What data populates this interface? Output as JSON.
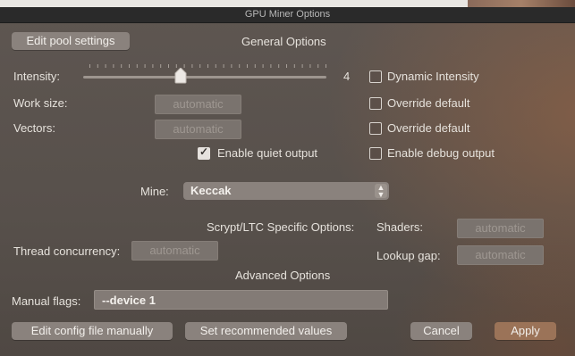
{
  "window": {
    "title": "GPU Miner Options"
  },
  "header": {
    "edit_pool_button": "Edit pool settings",
    "section_title": "General Options"
  },
  "intensity": {
    "label": "Intensity:",
    "value": "4",
    "slider_level": 0.4,
    "dynamic_label": "Dynamic Intensity",
    "dynamic_checked": false
  },
  "work_size": {
    "label": "Work size:",
    "placeholder": "automatic",
    "override_label": "Override default",
    "override_checked": false
  },
  "vectors": {
    "label": "Vectors:",
    "placeholder": "automatic",
    "override_label": "Override default",
    "override_checked": false
  },
  "quiet_output": {
    "label": "Enable quiet output",
    "checked": true
  },
  "debug_output": {
    "label": "Enable debug output",
    "checked": false
  },
  "mine": {
    "label": "Mine:",
    "selected": "Keccak"
  },
  "scrypt": {
    "section_title": "Scrypt/LTC Specific Options:",
    "shaders_label": "Shaders:",
    "shaders_placeholder": "automatic",
    "thread_label": "Thread concurrency:",
    "thread_placeholder": "automatic",
    "lookup_label": "Lookup gap:",
    "lookup_placeholder": "automatic"
  },
  "advanced": {
    "section_title": "Advanced Options",
    "manual_flags_label": "Manual flags:",
    "manual_flags_value": "--device 1"
  },
  "footer": {
    "edit_config_button": "Edit config file manually",
    "recommended_button": "Set recommended values",
    "cancel_button": "Cancel",
    "apply_button": "Apply"
  }
}
